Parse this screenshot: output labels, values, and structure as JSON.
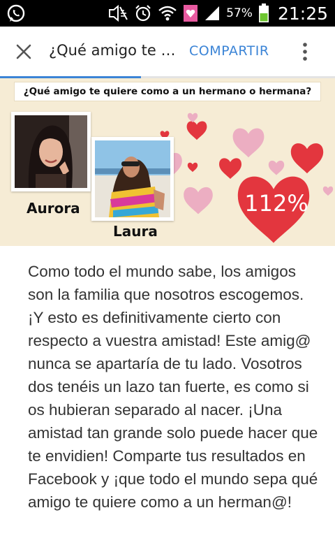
{
  "status_bar": {
    "battery_percent": "57%",
    "time": "21:25",
    "icons": [
      "whatsapp-icon",
      "mute-icon",
      "alarm-icon",
      "wifi-icon",
      "gallery-icon",
      "signal-icon",
      "battery-icon"
    ]
  },
  "toolbar": {
    "title": "¿Qué amigo te quiere como a un hermano o hermana?",
    "share_label": "COMPARTIR",
    "icons": [
      "close-icon",
      "more-vert-icon"
    ],
    "load_progress": 0.42,
    "accent": "#3b84d6"
  },
  "quiz": {
    "heading": "¿Qué amigo te quiere como a un hermano o hermana?",
    "person_1": "Aurora",
    "person_2": "Laura",
    "result": "112%",
    "colors": {
      "background": "#f6ecd5",
      "heart_red": "#e3363e",
      "heart_pink": "#ecaec2"
    }
  },
  "body_text": "Como todo el mundo sabe, los amigos son la familia que nosotros escogemos. ¡Y esto es definitivamente cierto con respecto a vuestra amistad! Este amig@ nunca se apartaría de tu lado. Vosotros dos tenéis un lazo tan fuerte, es como si os hubieran separado al nacer. ¡Una amistad tan grande solo puede hacer que te envidien! Comparte tus resultados en Facebook y ¡que todo el mundo sepa qué amigo te quiere como a un herman@!"
}
